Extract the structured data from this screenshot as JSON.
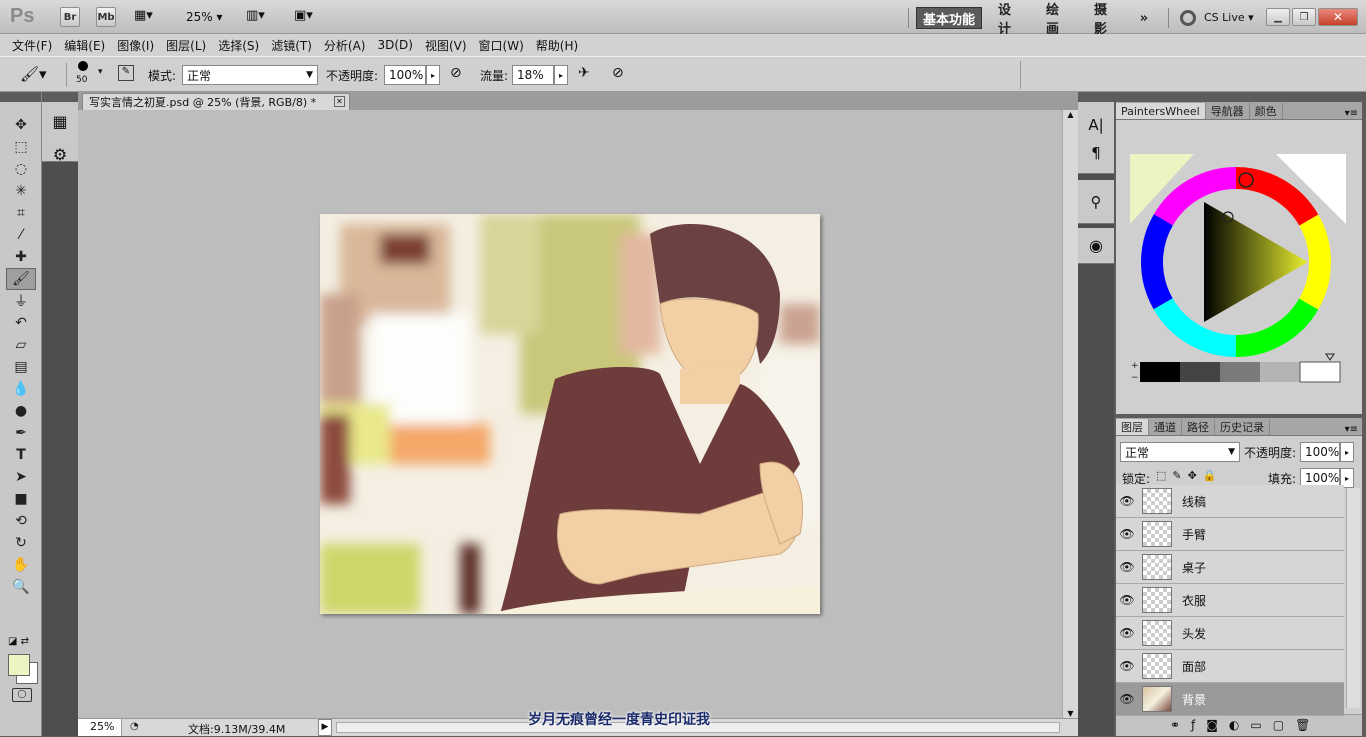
{
  "app": {
    "logo": "Ps",
    "bridge": "Br",
    "minibridge": "Mb",
    "zoom": "25%",
    "workspaces": [
      "基本功能",
      "设计",
      "绘画",
      "摄影"
    ],
    "more": "»",
    "cslive": "CS Live"
  },
  "menu": [
    "文件(F)",
    "编辑(E)",
    "图像(I)",
    "图层(L)",
    "选择(S)",
    "滤镜(T)",
    "分析(A)",
    "3D(D)",
    "视图(V)",
    "窗口(W)",
    "帮助(H)"
  ],
  "options": {
    "brush_size": "50",
    "mode_label": "模式:",
    "mode_value": "正常",
    "opacity_label": "不透明度:",
    "opacity_value": "100%",
    "flow_label": "流量:",
    "flow_value": "18%"
  },
  "document": {
    "tab_title": "写实言情之初夏.psd @ 25% (背景, RGB/8) *"
  },
  "status": {
    "zoom": "25%",
    "doc_info": "文档:9.13M/39.4M"
  },
  "painterswheel": {
    "tabs": [
      "PaintersWheel",
      "导航器",
      "颜色"
    ],
    "foreground": "#eef3c2"
  },
  "layers": {
    "tabs": [
      "图层",
      "通道",
      "路径",
      "历史记录"
    ],
    "blend_mode": "正常",
    "opacity_label": "不透明度:",
    "opacity_value": "100%",
    "lock_label": "锁定:",
    "fill_label": "填充:",
    "fill_value": "100%",
    "items": [
      {
        "name": "线稿"
      },
      {
        "name": "手臂"
      },
      {
        "name": "桌子"
      },
      {
        "name": "衣服"
      },
      {
        "name": "头发"
      },
      {
        "name": "面部"
      },
      {
        "name": "背景"
      }
    ]
  },
  "caption": "岁月无痕曾经一度青史印证我"
}
